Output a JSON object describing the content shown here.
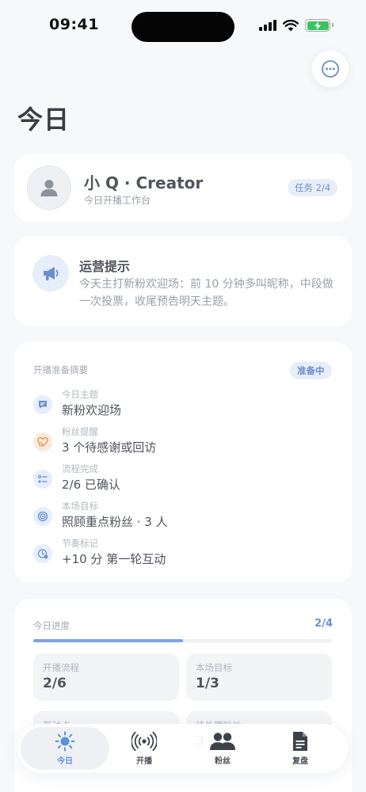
{
  "status_bar": {
    "time": "09:41"
  },
  "header": {
    "title": "今日"
  },
  "profile": {
    "name": "小 Q · Creator",
    "subtitle": "今日开播工作台",
    "task_badge": "任务 2/4"
  },
  "tip": {
    "title": "运营提示",
    "body": "今天主打新粉欢迎场：前 10 分钟多叫昵称，中段做一次投票，收尾预告明天主题。"
  },
  "summary": {
    "title": "开播准备摘要",
    "badge": "准备中",
    "items": [
      {
        "label": "今日主题",
        "value": "新粉欢迎场",
        "icon": "chat-bubble-icon",
        "color": "#6b8fcf"
      },
      {
        "label": "粉丝提醒",
        "value": "3 个待感谢或回访",
        "icon": "heart-plus-icon",
        "color": "#e39a5a"
      },
      {
        "label": "流程完成",
        "value": "2/6 已确认",
        "icon": "checklist-icon",
        "color": "#6b8fcf"
      },
      {
        "label": "本场目标",
        "value": "照顾重点粉丝 · 3 人",
        "icon": "target-icon",
        "color": "#6b8fcf"
      },
      {
        "label": "节奏标记",
        "value": "+10 分 第一轮互动",
        "icon": "timer-icon",
        "color": "#6b8fcf"
      }
    ]
  },
  "progress": {
    "title": "今日进度",
    "count": "2/4",
    "fraction": 0.5,
    "stats": [
      {
        "label": "开播流程",
        "value": "2/6"
      },
      {
        "label": "本场目标",
        "value": "1/3"
      },
      {
        "label": "互动点",
        "value": ""
      },
      {
        "label": "待处理粉丝",
        "value": "3"
      }
    ]
  },
  "tabs": [
    {
      "label": "今日",
      "icon": "sun-icon",
      "active": true
    },
    {
      "label": "开播",
      "icon": "broadcast-icon",
      "active": false
    },
    {
      "label": "粉丝",
      "icon": "fans-icon",
      "active": false
    },
    {
      "label": "复盘",
      "icon": "document-icon",
      "active": false
    }
  ]
}
